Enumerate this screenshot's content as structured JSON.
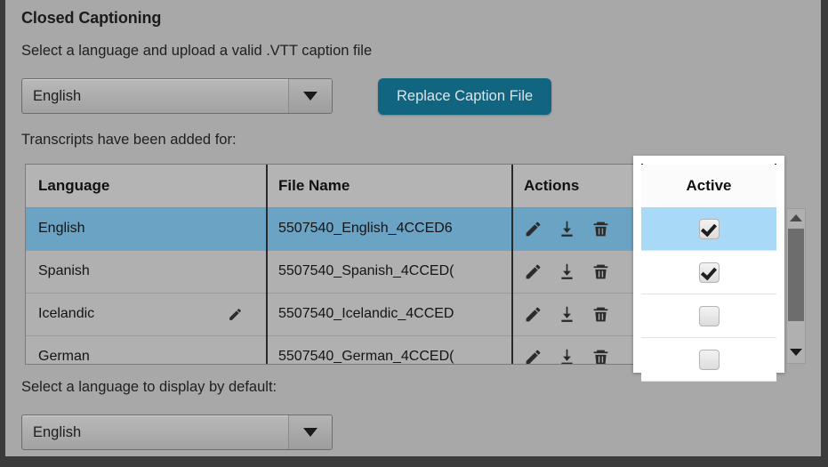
{
  "section": {
    "title": "Closed Captioning",
    "subtitle": "Select a language and upload a valid .VTT caption file",
    "transcripts_label": "Transcripts have been added for:",
    "default_language_label": "Select a language to display by default:"
  },
  "language_select": {
    "value": "English",
    "caret_icon": "chevron-down-icon"
  },
  "replace_button": {
    "label": "Replace Caption File",
    "color": "#116580"
  },
  "table": {
    "headers": {
      "language": "Language",
      "file_name": "File Name",
      "actions": "Actions",
      "active": "Active"
    },
    "rows": [
      {
        "language": "English",
        "file_name": "5507540_English_4CCED6",
        "active": true,
        "selected": true,
        "lang_edit_icon": false
      },
      {
        "language": "Spanish",
        "file_name": "5507540_Spanish_4CCED(",
        "active": true,
        "selected": false,
        "lang_edit_icon": false
      },
      {
        "language": "Icelandic",
        "file_name": "5507540_Icelandic_4CCED",
        "active": false,
        "selected": false,
        "lang_edit_icon": true
      },
      {
        "language": "German",
        "file_name": "5507540_German_4CCED(",
        "active": false,
        "selected": false,
        "lang_edit_icon": false
      }
    ],
    "action_icons": [
      "pencil-icon",
      "download-icon",
      "trash-icon"
    ],
    "selected_row_color": "#6ba3c4",
    "active_selected_color": "#a8daf7"
  },
  "default_language_select": {
    "value": "English",
    "caret_icon": "chevron-down-icon"
  },
  "scrollbar": {
    "up_icon": "triangle-up-icon",
    "down_icon": "triangle-down-icon"
  }
}
